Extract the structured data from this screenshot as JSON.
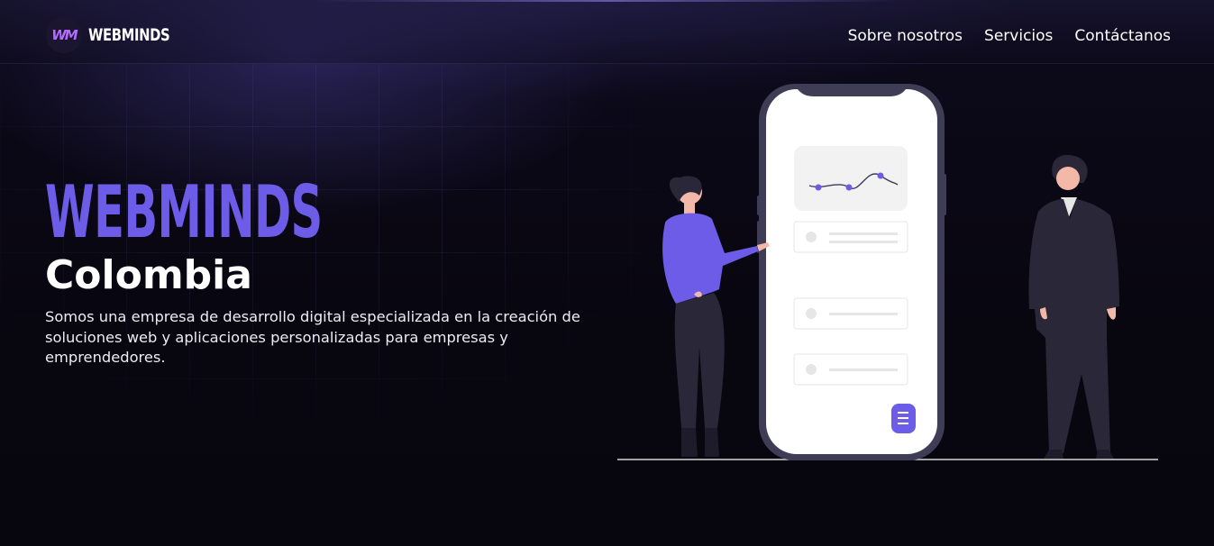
{
  "header": {
    "logo_initials": "WM",
    "brand": "WEBMINDS",
    "nav": [
      {
        "label": "Sobre nosotros"
      },
      {
        "label": "Servicios"
      },
      {
        "label": "Contáctanos"
      }
    ]
  },
  "hero": {
    "title": "WEBMINDS",
    "subtitle": "Colombia",
    "description": "Somos una empresa de desarrollo digital especializada en la creación de soluciones web y aplicaciones personalizadas para empresas y emprendedores."
  },
  "colors": {
    "accent": "#6c5ce7",
    "background": "#08060f",
    "figure_dark": "#2a2838",
    "phone_frame": "#3f3d56"
  },
  "illustration": {
    "icon": "phone-app-people-illustration"
  }
}
